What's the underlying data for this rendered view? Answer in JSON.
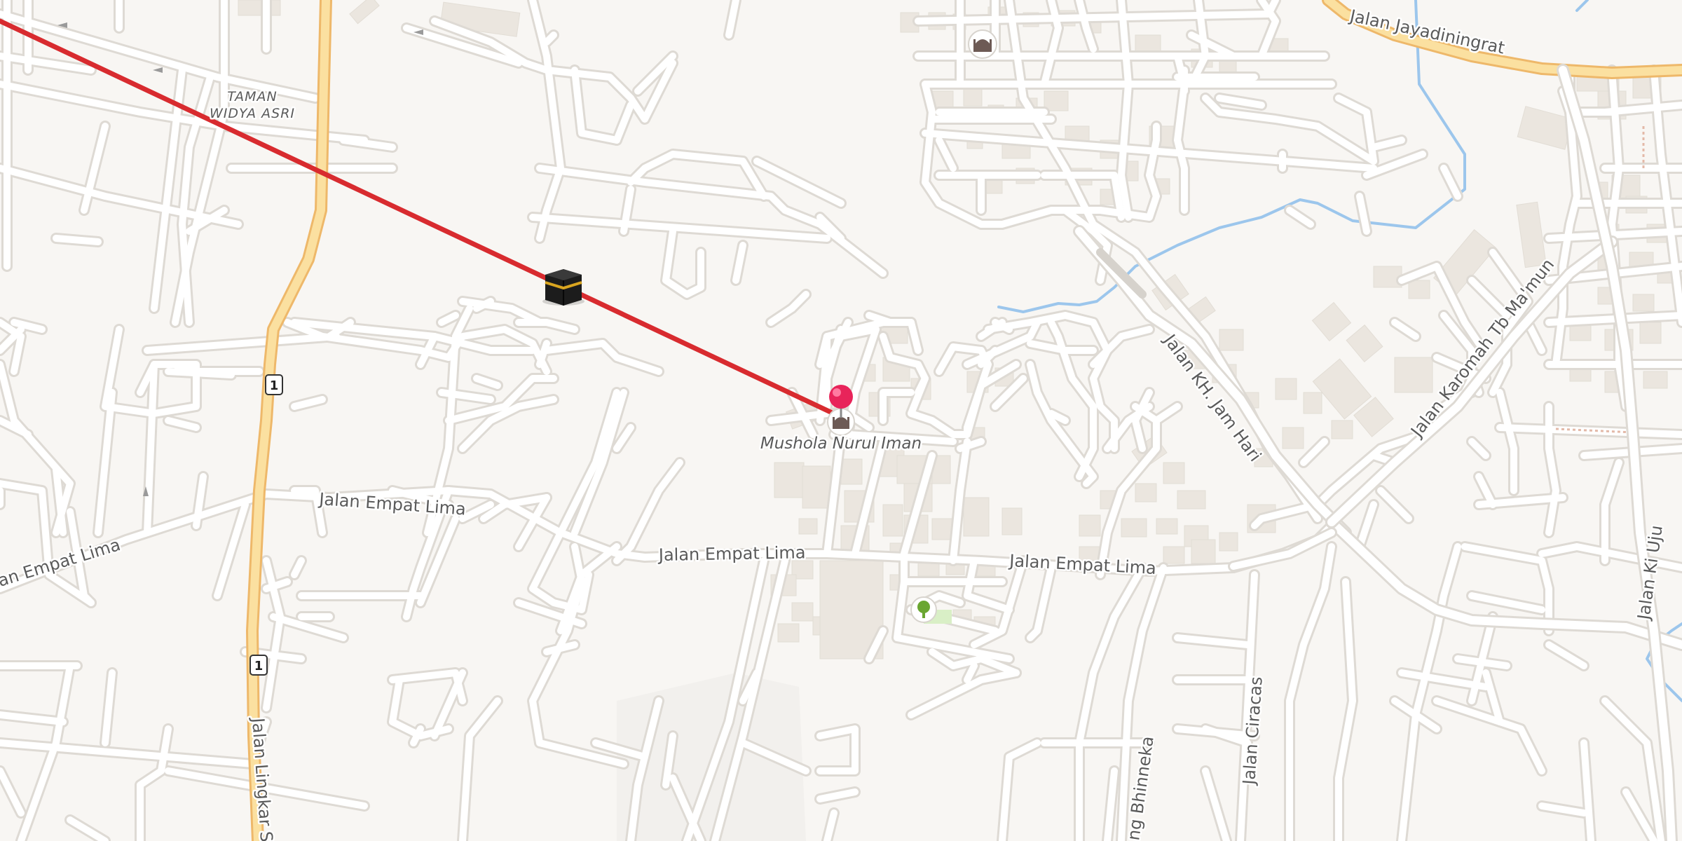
{
  "map": {
    "colors": {
      "background": "#f8f6f3",
      "minor_road": "#ffffff",
      "road_casing": "#dedad4",
      "primary_road": "#fbe0a0",
      "primary_road_casing": "#eeb86a",
      "building": "#ebe6df",
      "river": "#9cc6ec",
      "qibla_line": "#d82b2f",
      "pin": "#e8245a"
    },
    "roads": {
      "jalan_empat_lima_west": "an Empat Lima",
      "jalan_empat_lima_1": "Jalan Empat Lima",
      "jalan_empat_lima_2": "Jalan Empat Lima",
      "jalan_empat_lima_3": "Jalan Empat Lima",
      "jalan_jayadiningrat": "Jalan Jayadiningrat",
      "jalan_kh_jam_hari": "Jalan KH. Jam Hari",
      "jalan_karomah": "Jalan Karomah Tb Ma'mun",
      "jalan_ki_uju": "Jalan Ki Uju",
      "jalan_ciracas": "Jalan Ciracas",
      "jalan_bhinneka": "ng Bhinneka",
      "jalan_lingkar": "Jalan Lingkar S"
    },
    "area": {
      "line1": "TAMAN",
      "line2": "WIDYA ASRI"
    },
    "route_shield": "1",
    "poi": {
      "name": "Mushola Nurul Iman",
      "type": "mosque-icon"
    },
    "markers": {
      "kaaba": "kaaba-icon",
      "pin": "location-pin-icon",
      "park": "tree-icon",
      "mosque_top": "mosque-icon"
    }
  }
}
